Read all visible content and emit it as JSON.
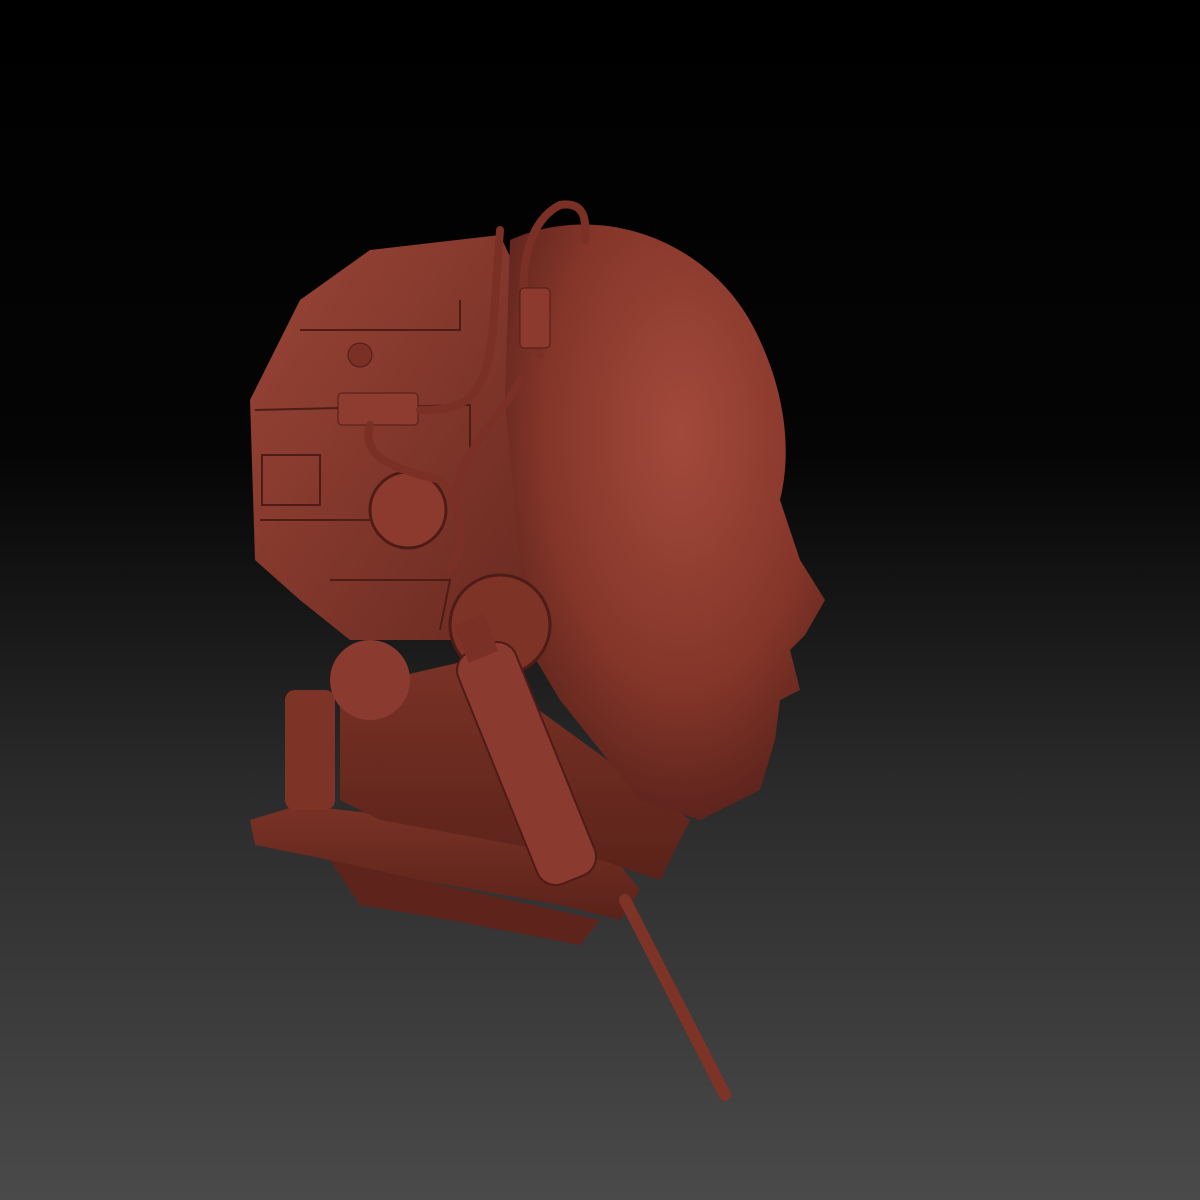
{
  "scene": {
    "subject": "cyborg-head-sculpt",
    "colors": {
      "material_base": "#8a3a2f",
      "material_light": "#a54a3c",
      "material_shadow": "#4e1c16",
      "background_top": "#000000",
      "background_bottom": "#4a4a4a"
    }
  }
}
